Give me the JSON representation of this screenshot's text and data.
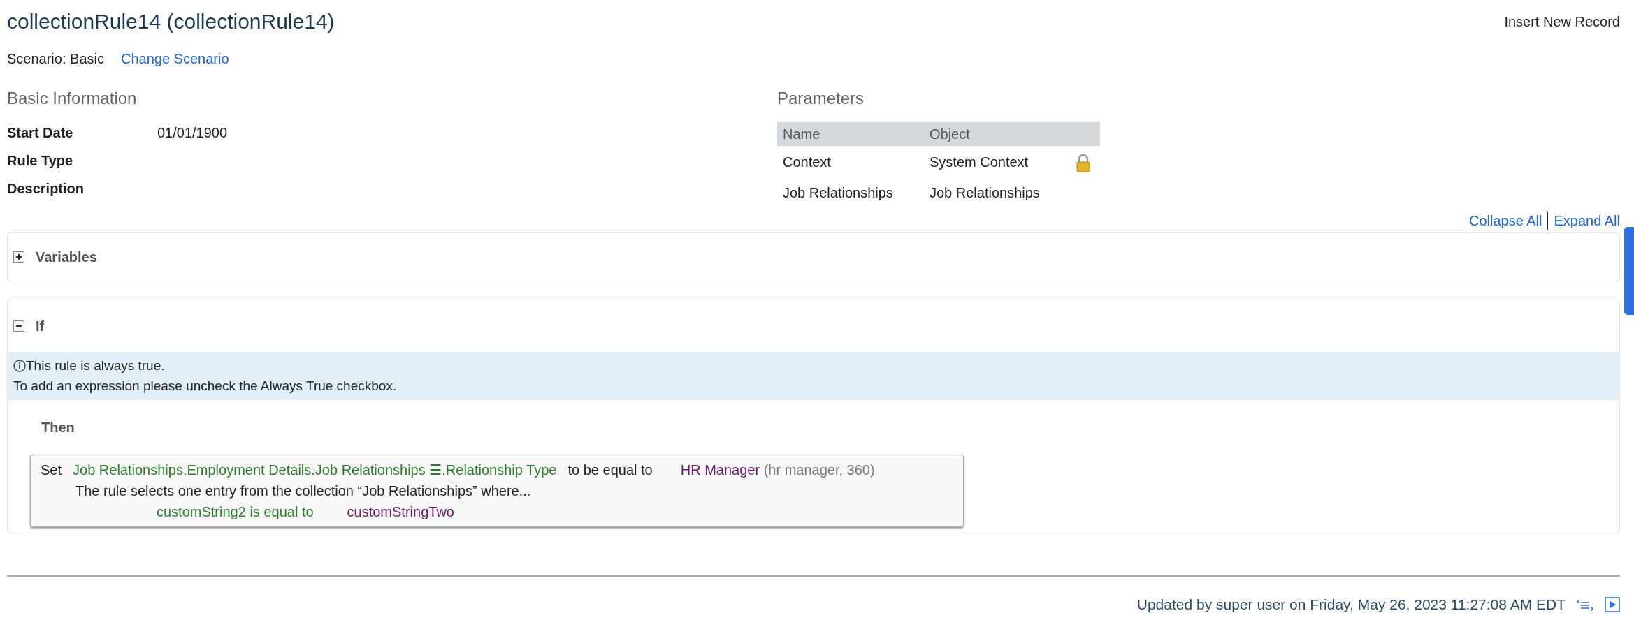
{
  "title": "collectionRule14 (collectionRule14)",
  "insert_link": "Insert New Record",
  "scenario": {
    "label": "Scenario: Basic",
    "change_link": "Change Scenario"
  },
  "basic_information": {
    "heading": "Basic Information",
    "fields": [
      {
        "label": "Start Date",
        "value": "01/01/1900"
      },
      {
        "label": "Rule Type"
      },
      {
        "label": "Description"
      }
    ]
  },
  "parameters": {
    "heading": "Parameters",
    "columns": [
      "Name",
      "Object"
    ],
    "rows": [
      {
        "name": "Context",
        "object": "System Context",
        "locked": true
      },
      {
        "name": "Job Relationships",
        "object": "Job Relationships",
        "locked": false
      }
    ]
  },
  "collapse_all": "Collapse All",
  "expand_all": "Expand All",
  "sections": [
    {
      "title": "Variables",
      "expanded": false
    },
    {
      "title": "If",
      "expanded": true,
      "info": [
        "This rule is always true.",
        "To add an expression please uncheck the Always True checkbox."
      ],
      "then_label": "Then",
      "action": {
        "verb": "Set",
        "target": "Job Relationships.Employment Details.Job Relationships ☰.Relationship Type",
        "operator": "to be equal to",
        "value": "HR Manager",
        "value_detail": "(hr manager, 360)",
        "description": "The rule selects one entry from the collection “Job Relationships” where...",
        "condition_field": "customString2 is equal to",
        "condition_value": "customStringTwo"
      }
    }
  ],
  "footer": {
    "updated": "Updated by super user on Friday, May 26, 2023 11:27:08 AM EDT"
  }
}
